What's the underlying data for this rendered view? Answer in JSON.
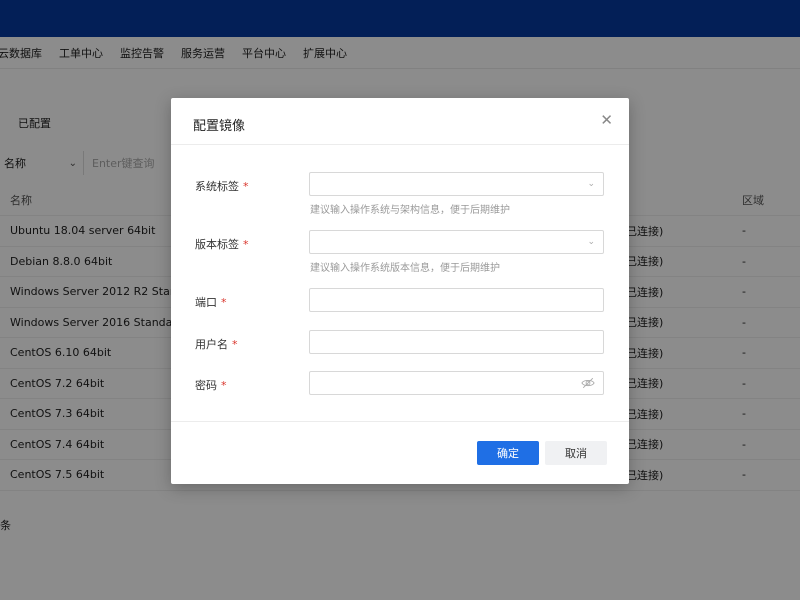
{
  "nav": {
    "items": [
      "云数据库",
      "工单中心",
      "监控告警",
      "服务运营",
      "平台中心",
      "扩展中心"
    ]
  },
  "page": {
    "subtab": "已配置",
    "filter": {
      "select_value": "名称",
      "input_placeholder": "Enter键查询"
    },
    "table": {
      "headers": {
        "name": "名称",
        "region": "区域"
      },
      "rows": [
        {
          "name": "Ubuntu 18.04 server 64bit",
          "conn": "已连接)",
          "region": "-"
        },
        {
          "name": "Debian 8.8.0 64bit",
          "conn": "已连接)",
          "region": "-"
        },
        {
          "name": "Windows Server 2012 R2 Stand...",
          "conn": "已连接)",
          "region": "-"
        },
        {
          "name": "Windows Server 2016 Standard ...",
          "conn": "已连接)",
          "region": "-"
        },
        {
          "name": "CentOS 6.10 64bit",
          "conn": "已连接)",
          "region": "-"
        },
        {
          "name": "CentOS 7.2 64bit",
          "conn": "已连接)",
          "region": "-"
        },
        {
          "name": "CentOS 7.3 64bit",
          "conn": "已连接)",
          "region": "-"
        },
        {
          "name": "CentOS 7.4 64bit",
          "conn": "已连接)",
          "region": "-"
        },
        {
          "name": "CentOS 7.5 64bit",
          "conn": "已连接)",
          "region": "-"
        }
      ]
    },
    "footer_text": "条"
  },
  "modal": {
    "title": "配置镜像",
    "close_icon": "close-icon",
    "fields": {
      "os_tag": {
        "label": "系统标签",
        "required": "*",
        "value": "",
        "hint": "建议输入操作系统与架构信息，便于后期维护"
      },
      "version_tag": {
        "label": "版本标签",
        "required": "*",
        "value": "",
        "hint": "建议输入操作系统版本信息，便于后期维护"
      },
      "port": {
        "label": "端口",
        "required": "*",
        "value": ""
      },
      "username": {
        "label": "用户名",
        "required": "*",
        "value": ""
      },
      "password": {
        "label": "密码",
        "required": "*",
        "value": ""
      }
    },
    "buttons": {
      "confirm": "确定",
      "cancel": "取消"
    }
  },
  "colors": {
    "topbar": "#063a9e",
    "primary": "#1f6fe5",
    "required": "#d9342b"
  }
}
